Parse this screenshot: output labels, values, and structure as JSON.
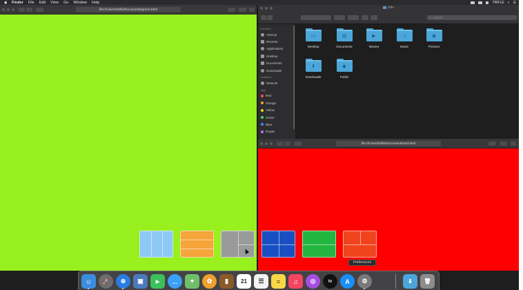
{
  "menubar": {
    "app_name": "Finder",
    "menus": [
      "File",
      "Edit",
      "View",
      "Go",
      "Window",
      "Help"
    ],
    "user": "TRIFLE"
  },
  "left_browser": {
    "url": "file:///Users/trifle/Documents/green.html",
    "bg_color": "#98f01e"
  },
  "right_browser": {
    "url": "file:///Users/trifle/Documents/red.html",
    "bg_color": "#ff0000"
  },
  "finder": {
    "title": "trifle",
    "search_placeholder": "Search",
    "sidebar": {
      "favorites_heading": "Favorites",
      "favorites": [
        "AirDrop",
        "Recents",
        "Applications",
        "Desktop",
        "Documents",
        "Downloads"
      ],
      "locations_heading": "Locations",
      "locations": [
        "Network"
      ],
      "tags_heading": "Tags",
      "tags": [
        {
          "label": "Red",
          "color": "#ff4d4d"
        },
        {
          "label": "Orange",
          "color": "#f5a623"
        },
        {
          "label": "Yellow",
          "color": "#f8d800"
        },
        {
          "label": "Green",
          "color": "#4cd964"
        },
        {
          "label": "Blue",
          "color": "#3a8ef6"
        },
        {
          "label": "Purple",
          "color": "#c46ee8"
        }
      ]
    },
    "files": [
      {
        "label": "Desktop",
        "glyph": "▭"
      },
      {
        "label": "Documents",
        "glyph": "▤"
      },
      {
        "label": "Movies",
        "glyph": "▶"
      },
      {
        "label": "Music",
        "glyph": "♫"
      },
      {
        "label": "Pictures",
        "glyph": "◉"
      },
      {
        "label": "Downloads",
        "glyph": "⬇"
      },
      {
        "label": "Public",
        "glyph": "◆"
      }
    ]
  },
  "layout_swatches": [
    {
      "name": "vertical-thirds",
      "color": "#8ec8f5"
    },
    {
      "name": "horizontal-thirds",
      "color": "#f5a53a"
    },
    {
      "name": "split-grid",
      "color": "#9a9a9a"
    },
    {
      "name": "quad-grid",
      "color": "#1a4fc4"
    },
    {
      "name": "half-split",
      "color": "#22b640"
    },
    {
      "name": "top-half-grid",
      "color": "#f0441e"
    }
  ],
  "tooltip": "Preferences",
  "dock": {
    "apps": [
      {
        "name": "finder",
        "color": "#3b8ede",
        "glyph": "☺"
      },
      {
        "name": "launchpad",
        "color": "#6d6d6d",
        "glyph": "🚀"
      },
      {
        "name": "safari",
        "color": "#2a7ce0",
        "glyph": "⊕"
      },
      {
        "name": "preview",
        "color": "#4a7ab8",
        "glyph": "▣"
      },
      {
        "name": "facetime",
        "color": "#3cc05a",
        "glyph": "▶"
      },
      {
        "name": "messages",
        "color": "#3aa0f8",
        "glyph": "…"
      },
      {
        "name": "maps",
        "color": "#6fbf6a",
        "glyph": "⌖"
      },
      {
        "name": "photos",
        "color": "#f0a030",
        "glyph": "✿"
      },
      {
        "name": "notes-book",
        "color": "#8a5a2a",
        "glyph": "▮"
      },
      {
        "name": "calendar",
        "color": "#ffffff",
        "glyph": "21"
      },
      {
        "name": "reminders",
        "color": "#f2f2f2",
        "glyph": "☰"
      },
      {
        "name": "notes",
        "color": "#f6d74a",
        "glyph": "≡"
      },
      {
        "name": "music",
        "color": "#f54560",
        "glyph": "♫"
      },
      {
        "name": "podcasts",
        "color": "#a54ee0",
        "glyph": "◎"
      },
      {
        "name": "tv",
        "color": "#111111",
        "glyph": "tv"
      },
      {
        "name": "app-store",
        "color": "#1b8ef5",
        "glyph": "A"
      },
      {
        "name": "system-preferences",
        "color": "#7a7a7a",
        "glyph": "⚙"
      },
      {
        "name": "downloads-stack",
        "color": "#4ca6d9",
        "glyph": "⬇"
      },
      {
        "name": "trash",
        "color": "#8c8c8c",
        "glyph": "🗑"
      }
    ]
  }
}
